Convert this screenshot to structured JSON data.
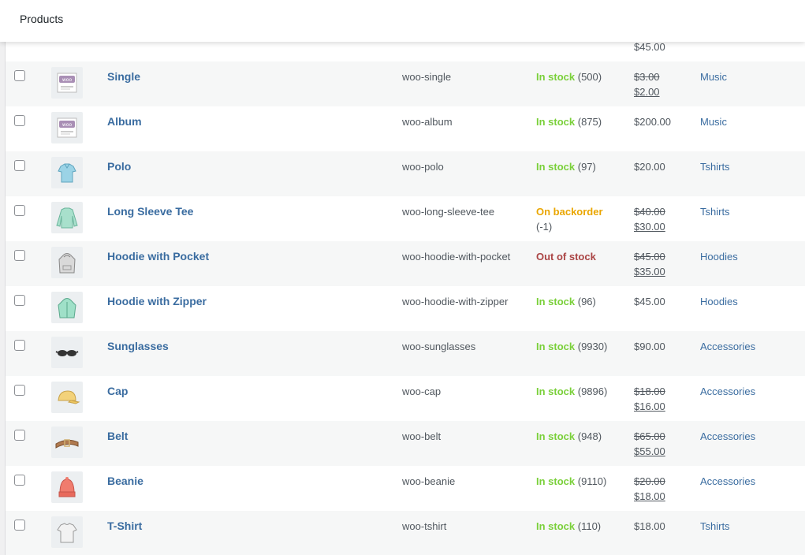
{
  "header": {
    "title": "Products"
  },
  "top_partial": {
    "price": "$45.00"
  },
  "rows": [
    {
      "name": "Single",
      "sku": "woo-single",
      "stock_label": "In stock",
      "stock_class": "instock",
      "stock_qty": "(500)",
      "price_regular": "$3.00",
      "price_sale": "$2.00",
      "category": "Music",
      "thumb": "woo-album-icon"
    },
    {
      "name": "Album",
      "sku": "woo-album",
      "stock_label": "In stock",
      "stock_class": "instock",
      "stock_qty": "(875)",
      "price_regular": "",
      "price_sale": "",
      "price": "$200.00",
      "category": "Music",
      "thumb": "woo-album-icon"
    },
    {
      "name": "Polo",
      "sku": "woo-polo",
      "stock_label": "In stock",
      "stock_class": "instock",
      "stock_qty": "(97)",
      "price": "$20.00",
      "category": "Tshirts",
      "thumb": "polo-shirt-icon"
    },
    {
      "name": "Long Sleeve Tee",
      "sku": "woo-long-sleeve-tee",
      "stock_label": "On backorder",
      "stock_class": "backorder",
      "stock_qty": "(-1)",
      "stock_qty_newline": true,
      "price_regular": "$40.00",
      "price_sale": "$30.00",
      "category": "Tshirts",
      "thumb": "long-sleeve-tee-icon"
    },
    {
      "name": "Hoodie with Pocket",
      "sku": "woo-hoodie-with-pocket",
      "stock_label": "Out of stock",
      "stock_class": "outofstock",
      "stock_qty": "",
      "price_regular": "$45.00",
      "price_sale": "$35.00",
      "category": "Hoodies",
      "thumb": "grey-hoodie-icon"
    },
    {
      "name": "Hoodie with Zipper",
      "sku": "woo-hoodie-with-zipper",
      "stock_label": "In stock",
      "stock_class": "instock",
      "stock_qty": "(96)",
      "price": "$45.00",
      "category": "Hoodies",
      "thumb": "zip-hoodie-icon"
    },
    {
      "name": "Sunglasses",
      "sku": "woo-sunglasses",
      "stock_label": "In stock",
      "stock_class": "instock",
      "stock_qty": "(9930)",
      "price": "$90.00",
      "category": "Accessories",
      "thumb": "sunglasses-icon"
    },
    {
      "name": "Cap",
      "sku": "woo-cap",
      "stock_label": "In stock",
      "stock_class": "instock",
      "stock_qty": "(9896)",
      "price_regular": "$18.00",
      "price_sale": "$16.00",
      "category": "Accessories",
      "thumb": "cap-icon"
    },
    {
      "name": "Belt",
      "sku": "woo-belt",
      "stock_label": "In stock",
      "stock_class": "instock",
      "stock_qty": "(948)",
      "price_regular": "$65.00",
      "price_sale": "$55.00",
      "category": "Accessories",
      "thumb": "belt-icon"
    },
    {
      "name": "Beanie",
      "sku": "woo-beanie",
      "stock_label": "In stock",
      "stock_class": "instock",
      "stock_qty": "(9110)",
      "price_regular": "$20.00",
      "price_sale": "$18.00",
      "category": "Accessories",
      "thumb": "beanie-icon"
    },
    {
      "name": "T-Shirt",
      "sku": "woo-tshirt",
      "stock_label": "In stock",
      "stock_class": "instock",
      "stock_qty": "(110)",
      "price": "$18.00",
      "category": "Tshirts",
      "thumb": "tshirt-icon"
    }
  ],
  "colors": {
    "link": "#3a6ca0",
    "instock": "#7ad03a",
    "backorder": "#eaa600",
    "outofstock": "#aa4444"
  }
}
